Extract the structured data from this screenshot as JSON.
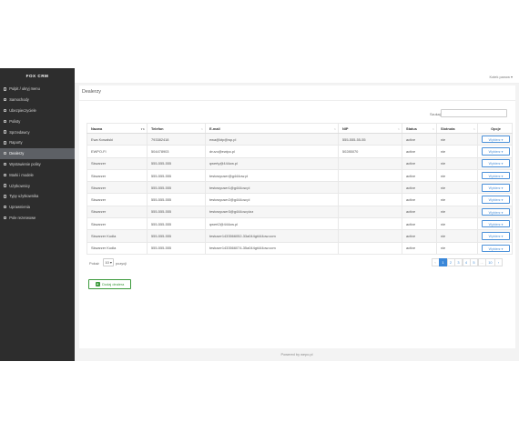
{
  "brand": "FOX CRM",
  "sidebar": {
    "items": [
      {
        "label": "Pulpit / ukryj menu"
      },
      {
        "label": "Samochody"
      },
      {
        "label": "Ubezpieczyciele"
      },
      {
        "label": "Polisty"
      },
      {
        "label": "Sprzedawcy"
      },
      {
        "label": "Raporty"
      },
      {
        "label": "Dealerzy"
      },
      {
        "label": "Wystawienie polisy"
      },
      {
        "label": "Marki i modele"
      },
      {
        "label": "Użytkownicy"
      },
      {
        "label": "Typy użytkownika"
      },
      {
        "label": "Uprawnienia"
      },
      {
        "label": "Pole rezerwowe"
      }
    ]
  },
  "topbar": {
    "user_menu": "Kotek panow ▾"
  },
  "page": {
    "title": "Dealerzy"
  },
  "search": {
    "label": "Szukaj:",
    "value": ""
  },
  "table": {
    "columns": [
      {
        "label": "Nazwa"
      },
      {
        "label": "Telefon"
      },
      {
        "label": "E-mail"
      },
      {
        "label": "NIP"
      },
      {
        "label": "Status"
      },
      {
        "label": "Slotnota"
      },
      {
        "label": "Opcje"
      }
    ],
    "rows": [
      {
        "name": "Ewa Kowalski",
        "phone": "793382418",
        "email": "ewa@ktp@wp.pl",
        "nip": "555-555-55-55",
        "status": "active",
        "slot": "nie",
        "option": "Wybierz ▾"
      },
      {
        "name": "EWPO-FI",
        "phone": "504478903",
        "email": "druvo@ewipo.pl",
        "nip": "50285070",
        "status": "active",
        "slot": "nie",
        "option": "Wybierz ▾"
      },
      {
        "name": "Skwarzer",
        "phone": "555-555-555",
        "email": "qwerty@444ow.pl",
        "nip": "",
        "status": "active",
        "slot": "nie",
        "option": "Wybierz ▾"
      },
      {
        "name": "Skwarzer",
        "phone": "555-555-555",
        "email": "testowyuser@g444ow.pl",
        "nip": "",
        "status": "active",
        "slot": "nie",
        "option": "Wybierz ▾"
      },
      {
        "name": "Skwarzer",
        "phone": "555-555-555",
        "email": "testowyuser1@g444ow.pl",
        "nip": "",
        "status": "active",
        "slot": "nie",
        "option": "Wybierz ▾"
      },
      {
        "name": "Skwarzer",
        "phone": "555-555-555",
        "email": "testowyuser2@g444ow.pl",
        "nip": "",
        "status": "active",
        "slot": "nie",
        "option": "Wybierz ▾"
      },
      {
        "name": "Skwarzer",
        "phone": "555-555-555",
        "email": "testowyuser3@g444ow.plzz",
        "nip": "",
        "status": "active",
        "slot": "nie",
        "option": "Wybierz ▾"
      },
      {
        "name": "Skwarzer",
        "phone": "555-555-555",
        "email": "qwert2@444ow.pl",
        "nip": "",
        "status": "active",
        "slot": "nie",
        "option": "Wybierz ▾"
      },
      {
        "name": "Skwarzer Kudła",
        "phone": "555-555-555",
        "email": "testuser1433566052-33a044gt444ow.com",
        "nip": "",
        "status": "active",
        "slot": "nie",
        "option": "Wybierz ▾"
      },
      {
        "name": "Skwarzer Kudła",
        "phone": "555-555-555",
        "email": "testuser1433566074-35a044gt444ow.com",
        "nip": "",
        "status": "active",
        "slot": "nie",
        "option": "Wybierz ▾"
      }
    ]
  },
  "length": {
    "prefix": "Pokaż",
    "value": "10 ▾",
    "suffix": "pozycji"
  },
  "pagination": {
    "prev": "‹",
    "pages": [
      "1",
      "2",
      "3",
      "4",
      "5",
      "...",
      "10"
    ],
    "next": "›"
  },
  "add_button": {
    "label": "Dodaj dealera",
    "icon": "+"
  },
  "footer": {
    "text": "Powered by wepo.pl"
  },
  "colors": {
    "sidebar": "#2d2d2d",
    "accent": "#3a87d8",
    "success": "#3c9a3c"
  }
}
